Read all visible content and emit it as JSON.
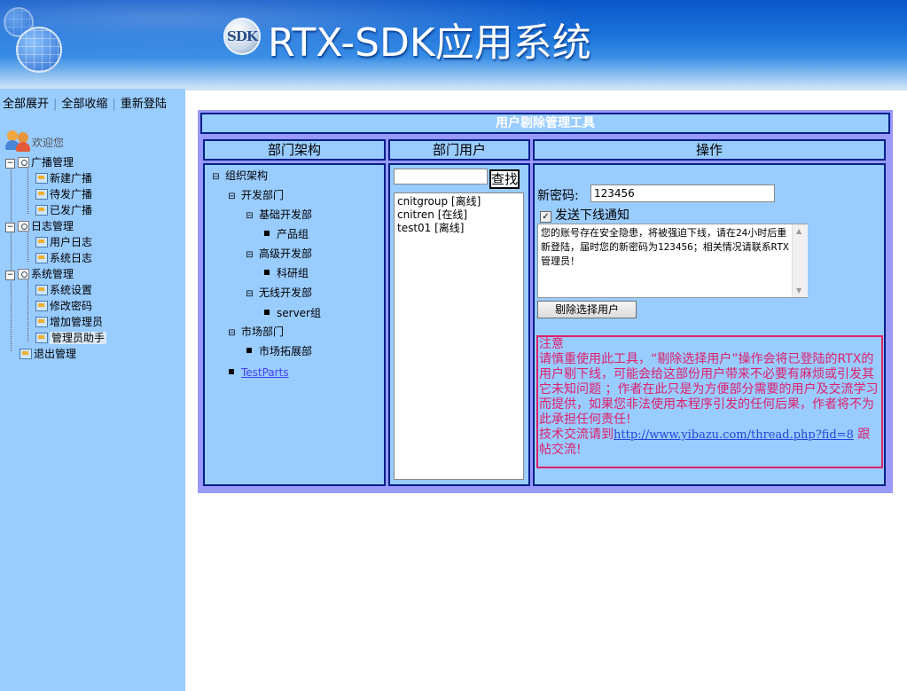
{
  "header": {
    "logo_text": "SDK",
    "title": "RTX-SDK应用系统"
  },
  "sidebar": {
    "top_links": [
      "全部展开",
      "全部收缩",
      "重新登陆"
    ],
    "welcome": "欢迎您",
    "tree": [
      {
        "label": "广播管理",
        "children": [
          "新建广播",
          "待发广播",
          "已发广播"
        ]
      },
      {
        "label": "日志管理",
        "children": [
          "用户日志",
          "系统日志"
        ]
      },
      {
        "label": "系统管理",
        "children": [
          "系统设置",
          "修改密码",
          "增加管理员",
          "管理员助手"
        ]
      },
      {
        "label": "退出管理"
      }
    ]
  },
  "tool": {
    "title": "用户剔除管理工具",
    "columns": [
      "部门架构",
      "部门用户",
      "操作"
    ],
    "dept_tree": {
      "root": "组织架构",
      "dev": "开发部门",
      "basic": "基础开发部",
      "product": "产品组",
      "advanced": "高级开发部",
      "research": "科研组",
      "wireless": "无线开发部",
      "server": "server组",
      "market": "市场部门",
      "market_ext": "市场拓展部",
      "test": "TestParts",
      "expand_glyph": "⊟"
    },
    "search": {
      "value": "",
      "button": "查找"
    },
    "users": [
      "cnitgroup [离线]",
      "cnitren [在线]",
      "test01 [离线]"
    ],
    "password_label": "新密码:",
    "password_value": "123456",
    "notify_label": "发送下线通知",
    "notify_checked": true,
    "message": "您的账号存在安全隐患，将被强迫下线，请在24小时后重新登陆，届时您的新密码为123456；相关情况请联系RTX管理员！",
    "kick_button": "剔除选择用户",
    "notice": {
      "heading": "注意",
      "body": "请慎重使用此工具，“剔除选择用户”操作会将已登陆的RTX的用户剔下线，可能会给这部份用户带来不必要有麻烦或引发其它未知问题 ；作者在此只是为方便部分需要的用户及交流学习而提供，如果您非法使用本程序引发的任何后果，作者将不为此承担任何责任!",
      "contact_prefix": "技术交流请到",
      "link": "http://www.yibazu.com/thread.php?fid=8",
      "contact_suffix": " 跟帖交流!"
    }
  },
  "colors": {
    "header_blue": "#1a73dc",
    "sidebar_bg": "#99ccff",
    "panel_frame": "#9999ff",
    "border_navy": "#00208a",
    "notice_red": "#e0206b"
  }
}
